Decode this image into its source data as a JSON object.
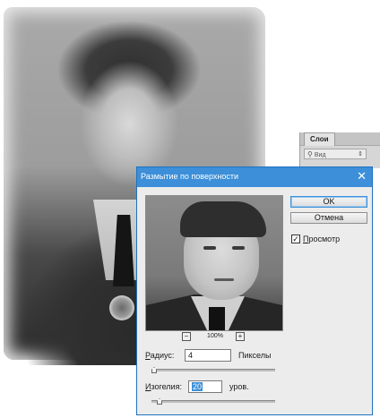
{
  "layers_panel": {
    "tab_label": "Слои",
    "filter_placeholder": "Вид",
    "filter_icon": "search-icon"
  },
  "dialog": {
    "title": "Размытие по поверхности",
    "close_glyph": "✕",
    "ok_label": "OK",
    "cancel_label": "Отмена",
    "preview_checked": true,
    "preview_label_underlined": "П",
    "preview_label_rest": "росмотр",
    "zoom": {
      "minus": "−",
      "plus": "+",
      "value": "100%"
    },
    "radius": {
      "label_underlined": "Р",
      "label_rest": "адиус:",
      "value": "4",
      "unit": "Пикселы",
      "slider_value": 4
    },
    "threshold": {
      "label_underlined": "И",
      "label_rest": "зогелия:",
      "value": "20",
      "unit": "уров.",
      "slider_value": 20
    },
    "colors": {
      "titlebar": "#3c8fd8",
      "accent": "#3c8fd8"
    }
  }
}
